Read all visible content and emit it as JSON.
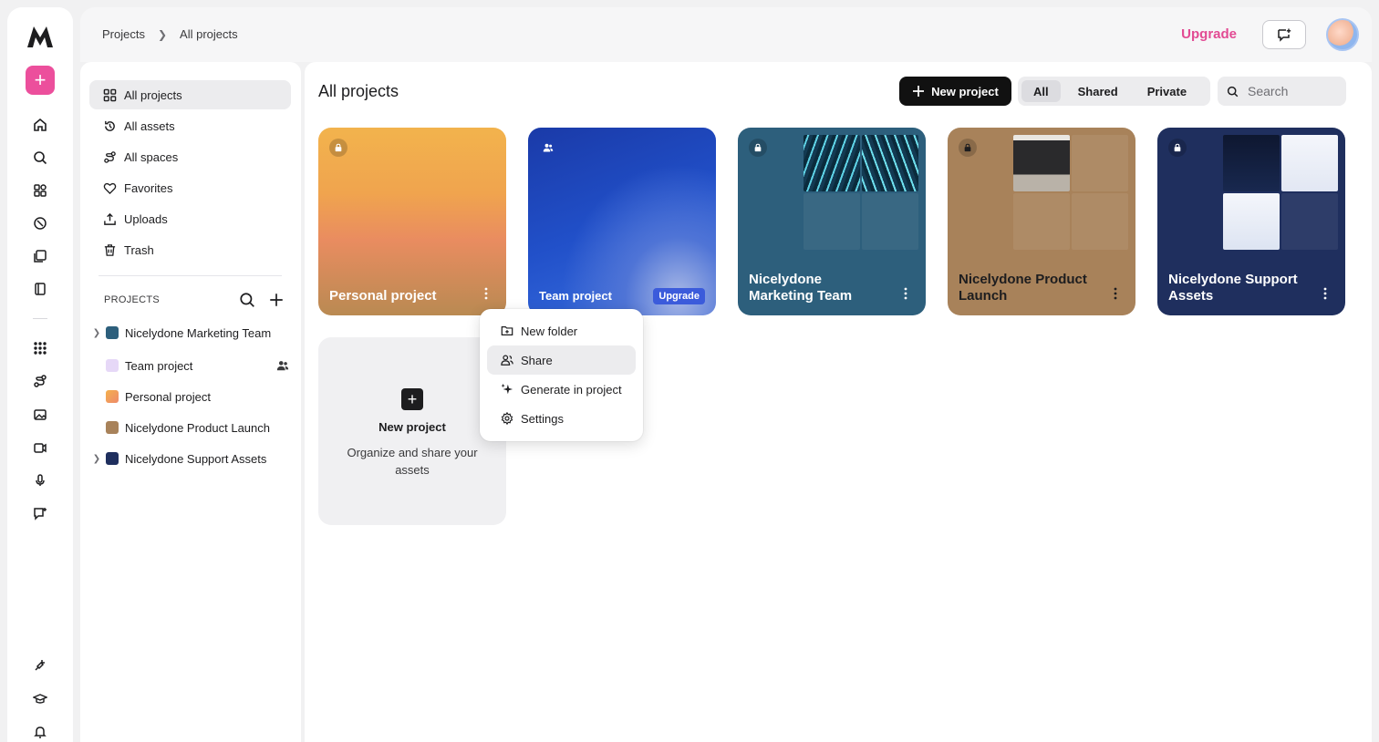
{
  "breadcrumb": [
    "Projects",
    "All projects"
  ],
  "header": {
    "upgrade": "Upgrade"
  },
  "sidebar": {
    "nav": [
      {
        "label": "All projects",
        "icon": "grid-icon",
        "active": true
      },
      {
        "label": "All assets",
        "icon": "history-icon"
      },
      {
        "label": "All spaces",
        "icon": "spaces-icon"
      },
      {
        "label": "Favorites",
        "icon": "heart-icon"
      },
      {
        "label": "Uploads",
        "icon": "upload-icon"
      },
      {
        "label": "Trash",
        "icon": "trash-icon"
      }
    ],
    "projects_heading": "PROJECTS",
    "projects": [
      {
        "label": "Nicelydone Marketing Team",
        "color": "#2d5f7c",
        "expandable": true
      },
      {
        "label": "Team project",
        "color": "#e6d8f7",
        "expandable": false,
        "shared": true
      },
      {
        "label": "Personal project",
        "color": "#f2a94e",
        "expandable": false
      },
      {
        "label": "Nicelydone Product Launch",
        "color": "#a8825a",
        "expandable": false
      },
      {
        "label": "Nicelydone Support Assets",
        "color": "#1f2f5e",
        "expandable": true
      }
    ]
  },
  "main": {
    "title": "All projects",
    "new_project": "New project",
    "filters": [
      "All",
      "Shared",
      "Private"
    ],
    "active_filter": "All",
    "search_placeholder": "Search",
    "cards": [
      {
        "title": "Personal project",
        "icon": "lock-icon"
      },
      {
        "title": "Team project",
        "icon": "team-icon",
        "badge": "Upgrade"
      },
      {
        "title": "Nicelydone Marketing Team",
        "icon": "lock-icon"
      },
      {
        "title": "Nicelydone Product Launch",
        "icon": "lock-icon"
      },
      {
        "title": "Nicelydone Support Assets",
        "icon": "lock-icon"
      }
    ],
    "new_card": {
      "title": "New project",
      "desc": "Organize and share your assets"
    }
  },
  "context_menu": {
    "items": [
      {
        "label": "New folder",
        "icon": "folder-plus-icon"
      },
      {
        "label": "Share",
        "icon": "share-icon",
        "hover": true
      },
      {
        "label": "Generate in project",
        "icon": "sparkle-icon"
      },
      {
        "label": "Settings",
        "icon": "gear-icon"
      }
    ]
  },
  "colors": {
    "accent": "#ec4f9c",
    "upgrade_badge": "#3b5bdb"
  }
}
